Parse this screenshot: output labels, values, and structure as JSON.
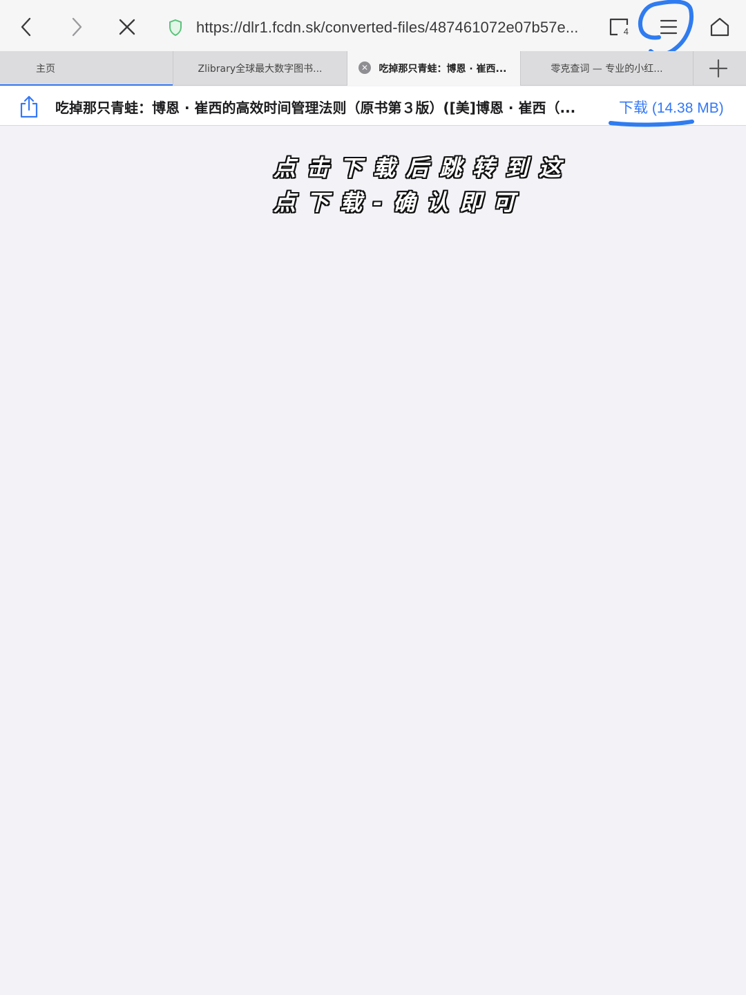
{
  "browser": {
    "url": "https://dlr1.fcdn.sk/converted-files/487461072e07b57e...",
    "tab_count": "4"
  },
  "tabs": [
    {
      "label": "主页"
    },
    {
      "label": "Zlibrary全球最大数字图书..."
    },
    {
      "label": "吃掉那只青蛙：博恩 · 崔西..."
    },
    {
      "label": "零克查词 — 专业的小红..."
    }
  ],
  "download": {
    "title": "吃掉那只青蛙：博恩 · 崔西的高效时间管理法则（原书第３版）([美]博恩 · 崔西（...",
    "link": "下载 (14.38 MB)"
  },
  "caption": {
    "line1": "点击下载后跳转到这",
    "line2": "点下载-确认即可"
  },
  "colors": {
    "accent": "#3478f6",
    "annotation": "#2f7cf0",
    "page_background": "#f2f2f7"
  },
  "icons": [
    "chevron-left-icon",
    "chevron-right-icon",
    "close-icon",
    "shield-icon",
    "tabs-icon",
    "menu-icon",
    "home-icon",
    "plus-icon",
    "share-icon"
  ]
}
